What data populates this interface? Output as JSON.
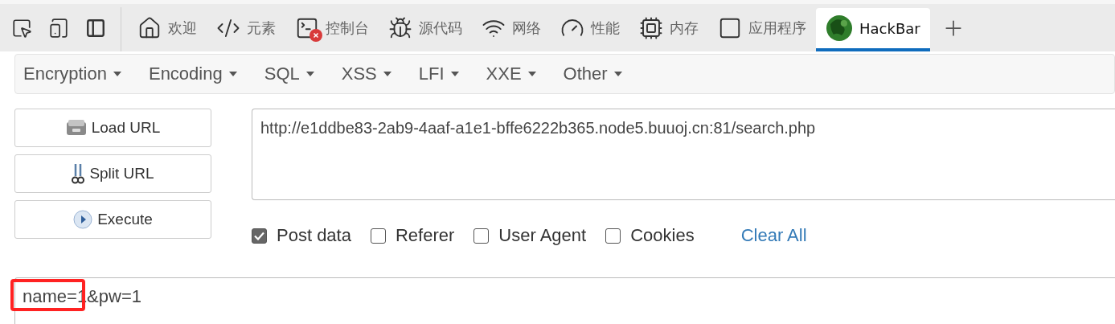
{
  "tabs": [
    {
      "label": "欢迎",
      "selected": false
    },
    {
      "label": "元素",
      "selected": false
    },
    {
      "label": "控制台",
      "selected": false
    },
    {
      "label": "源代码",
      "selected": false
    },
    {
      "label": "网络",
      "selected": false
    },
    {
      "label": "性能",
      "selected": false
    },
    {
      "label": "内存",
      "selected": false
    },
    {
      "label": "应用程序",
      "selected": false
    },
    {
      "label": "HackBar",
      "selected": true
    }
  ],
  "menu": [
    "Encryption",
    "Encoding",
    "SQL",
    "XSS",
    "LFI",
    "XXE",
    "Other"
  ],
  "actions": [
    "Load URL",
    "Split URL",
    "Execute"
  ],
  "url": {
    "value": "http://e1ddbe83-2ab9-4aaf-a1e1-bffe6222b365.node5.buuoj.cn:81/search.php"
  },
  "options": [
    {
      "label": "Post data",
      "checked": true
    },
    {
      "label": "Referer",
      "checked": false
    },
    {
      "label": "User Agent",
      "checked": false
    },
    {
      "label": "Cookies",
      "checked": false
    }
  ],
  "clear_link": "Clear All",
  "post_data": {
    "value": "name=1&pw=1"
  }
}
